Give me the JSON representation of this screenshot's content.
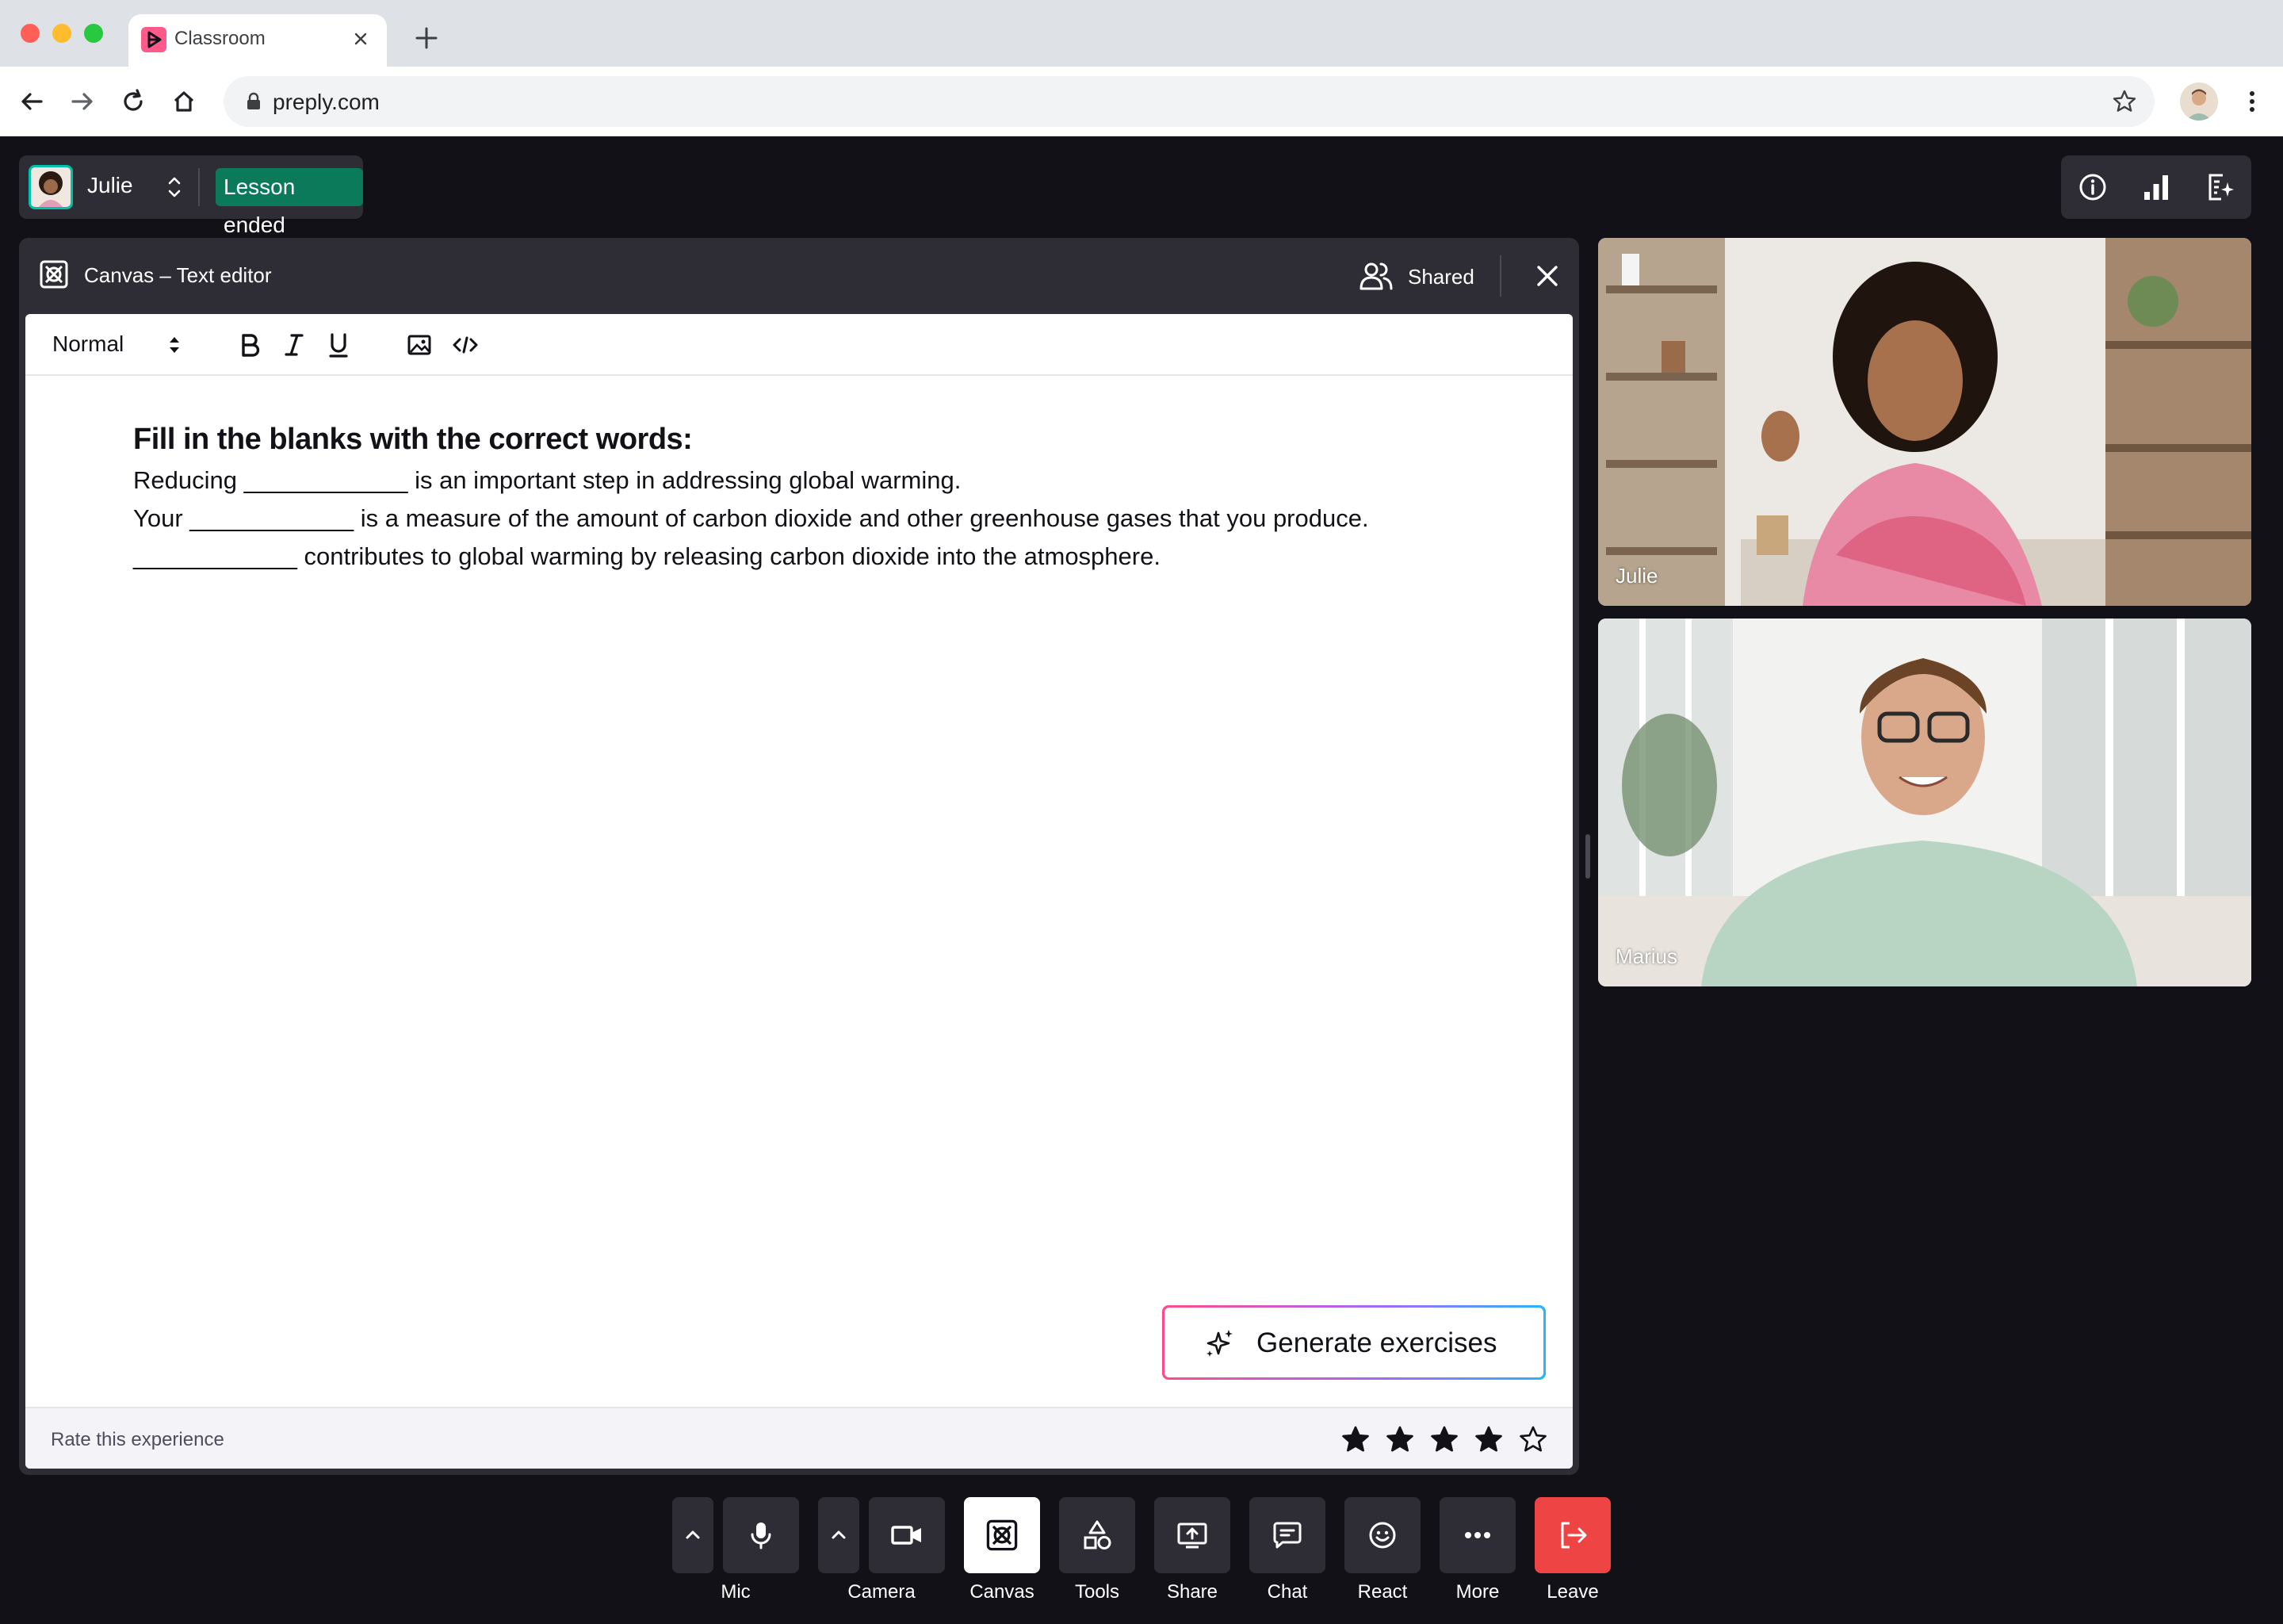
{
  "browser": {
    "tab_title": "Classroom",
    "url": "preply.com"
  },
  "session": {
    "student_name": "Julie",
    "status": "Lesson ended"
  },
  "canvas": {
    "title": "Canvas – Text editor",
    "shared_label": "Shared",
    "format_select": "Normal",
    "heading": "Fill in the blanks with the correct words:",
    "lines": [
      "Reducing ____________ is an important step in addressing global warming.",
      "Your ____________ is a measure of the amount of carbon dioxide and other greenhouse gases that you produce.",
      "____________ contributes to global warming by releasing carbon dioxide into the atmosphere."
    ],
    "generate_label": "Generate exercises",
    "rate_label": "Rate this experience",
    "rating": {
      "value": 4,
      "max": 5
    }
  },
  "participants": [
    {
      "name": "Julie"
    },
    {
      "name": "Marius"
    }
  ],
  "controls": {
    "mic": "Mic",
    "camera": "Camera",
    "canvas": "Canvas",
    "tools": "Tools",
    "share": "Share",
    "chat": "Chat",
    "react": "React",
    "more": "More",
    "leave": "Leave"
  },
  "colors": {
    "app_background": "#121117",
    "panel": "#2e2d36",
    "status_badge": "#0b7a5b",
    "leave": "#ef4444",
    "brand_pink": "#ff5a8a"
  }
}
